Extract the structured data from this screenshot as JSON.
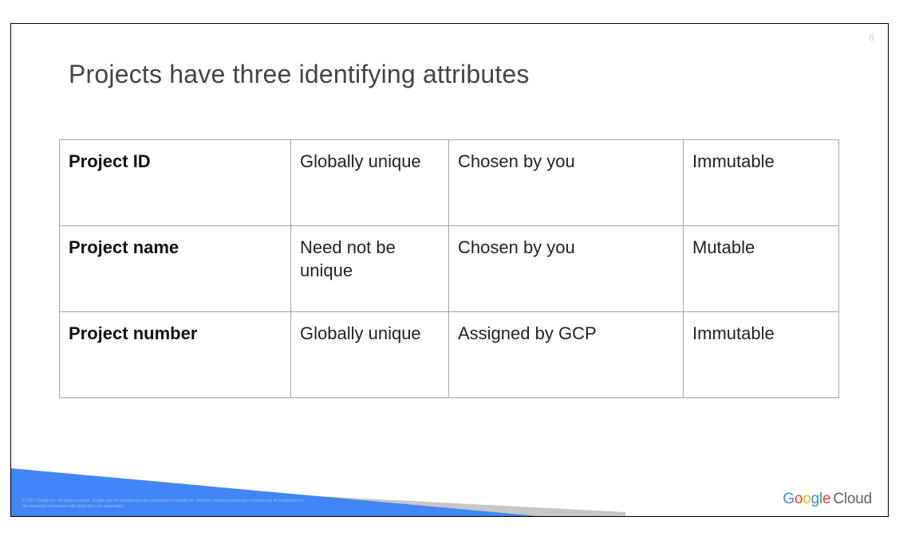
{
  "slide": {
    "number": "6",
    "title": "Projects have three identifying attributes"
  },
  "table": {
    "rows": [
      {
        "attribute": "Project ID",
        "uniqueness": "Globally unique",
        "chosen_by": "Chosen by you",
        "mutability": "Immutable"
      },
      {
        "attribute": "Project name",
        "uniqueness": "Need not be unique",
        "chosen_by": "Chosen by you",
        "mutability": "Mutable"
      },
      {
        "attribute": "Project number",
        "uniqueness": "Globally unique",
        "chosen_by": "Assigned by GCP",
        "mutability": "Immutable"
      }
    ]
  },
  "footer": {
    "copyright": "© 2017 Google Inc. All rights reserved. Google and the Google logo are trademarks of Google Inc. All other company and product names may be trademarks of the respective companies with which they are associated.",
    "logo_letters": [
      "G",
      "o",
      "o",
      "g",
      "l",
      "e"
    ],
    "logo_suffix": "Cloud"
  },
  "colors": {
    "accent_blue": "#4285f4",
    "footer_gray": "#c7c7c7",
    "table_border": "#a6a6a6"
  }
}
